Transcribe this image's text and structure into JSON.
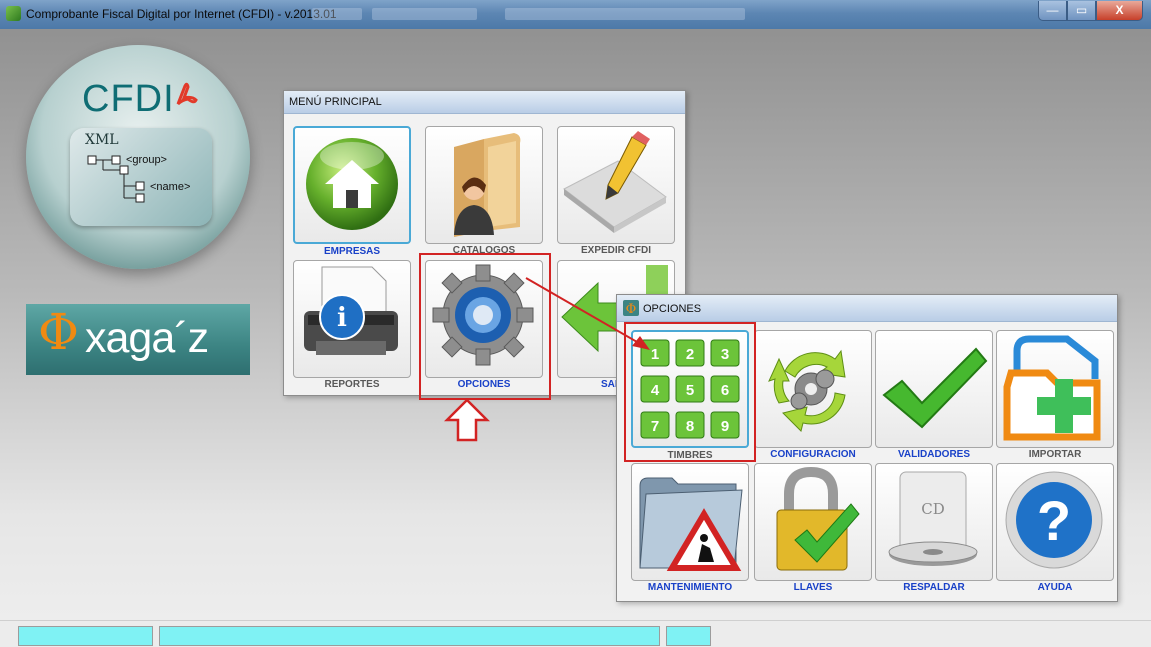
{
  "window": {
    "title": "Comprobante Fiscal Digital por Internet (CFDI) - v.2013.01",
    "buttons": {
      "minimize": "—",
      "maximize": "▭",
      "close": "X"
    }
  },
  "logo": {
    "cfdi_text": "CFDI",
    "xml_text": "XML",
    "group_text": "<group>",
    "name_text": "<name>",
    "brand_symbol": "Φ",
    "brand_text": "xaga´z"
  },
  "main_menu": {
    "title": "MENÚ PRINCIPAL",
    "tiles": [
      {
        "label": "EMPRESAS",
        "icon": "home-icon"
      },
      {
        "label": "CATALOGOS",
        "icon": "folder-person-icon"
      },
      {
        "label": "EXPEDIR CFDI",
        "icon": "pencil-document-icon"
      },
      {
        "label": "REPORTES",
        "icon": "printer-info-icon"
      },
      {
        "label": "OPCIONES",
        "icon": "gear-icon"
      },
      {
        "label": "SALIR",
        "icon": "green-arrow-icon"
      }
    ]
  },
  "options_menu": {
    "title": "OPCIONES",
    "tiles": [
      {
        "label": "TIMBRES",
        "icon": "number-grid-icon"
      },
      {
        "label": "CONFIGURACION",
        "icon": "gears-recycle-icon"
      },
      {
        "label": "VALIDADORES",
        "icon": "checkmark-icon"
      },
      {
        "label": "IMPORTAR",
        "icon": "import-plus-icon"
      },
      {
        "label": "MANTENIMIENTO",
        "icon": "maintenance-folder-icon"
      },
      {
        "label": "LLAVES",
        "icon": "padlock-icon"
      },
      {
        "label": "RESPALDAR",
        "icon": "cd-drive-icon"
      },
      {
        "label": "AYUDA",
        "icon": "help-icon"
      }
    ],
    "timbres_numbers": [
      "1",
      "2",
      "3",
      "4",
      "5",
      "6",
      "7",
      "8",
      "9"
    ],
    "cd_text": "CD"
  },
  "colors": {
    "accent_blue": "#1941c8",
    "annotation_red": "#d22323",
    "status_cyan": "#7ff2f4"
  }
}
